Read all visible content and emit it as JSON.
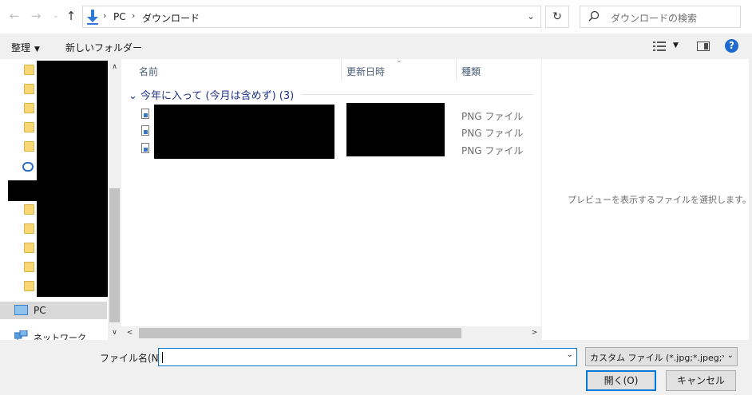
{
  "address": {
    "crumbs": [
      "PC",
      "ダウンロード"
    ],
    "search_placeholder": "ダウンロードの検索"
  },
  "toolbar": {
    "organize_label": "整理",
    "new_folder_label": "新しいフォルダー"
  },
  "nav": {
    "pc_label": "PC",
    "network_label": "ネットワーク"
  },
  "columns": {
    "name": "名前",
    "modified": "更新日時",
    "type": "種類"
  },
  "group": {
    "label": "今年に入って (今月は含めず) (3)"
  },
  "files": [
    {
      "type": "PNG ファイル"
    },
    {
      "type": "PNG ファイル"
    },
    {
      "type": "PNG ファイル"
    }
  ],
  "preview": {
    "message": "プレビューを表示するファイルを選択します。"
  },
  "footer": {
    "filename_label": "ファイル名(N):",
    "filename_value": "",
    "filter_label": "カスタム ファイル (*.jpg;*.jpeg;*.gif",
    "open_label": "開く(O)",
    "cancel_label": "キャンセル"
  },
  "colors": {
    "accent": "#0078d7",
    "group_header": "#1e3287",
    "help": "#1e6ad0"
  }
}
